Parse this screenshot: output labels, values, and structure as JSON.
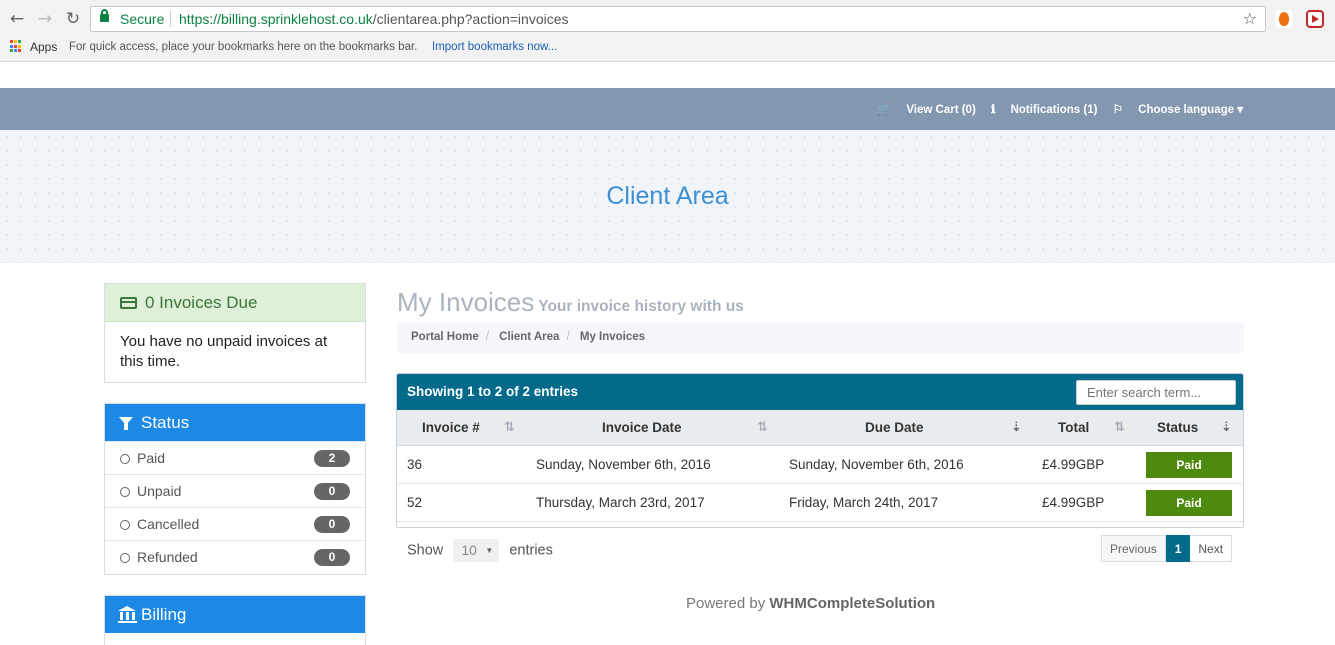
{
  "browser": {
    "secure_label": "Secure",
    "url_scheme_host": "https://billing.sprinklehost.co.uk",
    "url_path": "/clientarea.php?action=invoices",
    "bookmarks": {
      "apps": "Apps",
      "hint": "For quick access, place your bookmarks here on the bookmarks bar.",
      "import_link": "Import bookmarks now..."
    }
  },
  "topbar": {
    "view_cart": "View Cart (0)",
    "notifications": "Notifications (1)",
    "language": "Choose language"
  },
  "hero": {
    "title": "Client Area"
  },
  "sidebar": {
    "invoices_due": {
      "title": "0 Invoices Due",
      "body": "You have no unpaid invoices at this time."
    },
    "status": {
      "title": "Status",
      "items": [
        {
          "label": "Paid",
          "count": "2"
        },
        {
          "label": "Unpaid",
          "count": "0"
        },
        {
          "label": "Cancelled",
          "count": "0"
        },
        {
          "label": "Refunded",
          "count": "0"
        }
      ]
    },
    "billing": {
      "title": "Billing"
    }
  },
  "main": {
    "title": "My Invoices",
    "subtitle": "Your invoice history with us",
    "breadcrumb": [
      "Portal Home",
      "Client Area",
      "My Invoices"
    ],
    "table": {
      "showing": "Showing 1 to 2 of 2 entries",
      "search_placeholder": "Enter search term...",
      "columns": [
        "Invoice #",
        "Invoice Date",
        "Due Date",
        "Total",
        "Status"
      ],
      "rows": [
        {
          "invoice": "36",
          "invoice_date": "Sunday, November 6th, 2016",
          "due_date": "Sunday, November 6th, 2016",
          "total": "£4.99GBP",
          "status": "Paid"
        },
        {
          "invoice": "52",
          "invoice_date": "Thursday, March 23rd, 2017",
          "due_date": "Friday, March 24th, 2017",
          "total": "£4.99GBP",
          "status": "Paid"
        }
      ]
    },
    "show_label": "Show",
    "entries_value": "10",
    "entries_label": "entries",
    "pager": {
      "previous": "Previous",
      "current": "1",
      "next": "Next"
    }
  },
  "footer": {
    "powered_prefix": "Powered by",
    "powered_brand": "WHMCompleteSolution"
  },
  "colors": {
    "accent_blue": "#1e88e5",
    "table_header": "#036a8c",
    "paid_green": "#4f8a10",
    "topbar": "#8497b0"
  }
}
